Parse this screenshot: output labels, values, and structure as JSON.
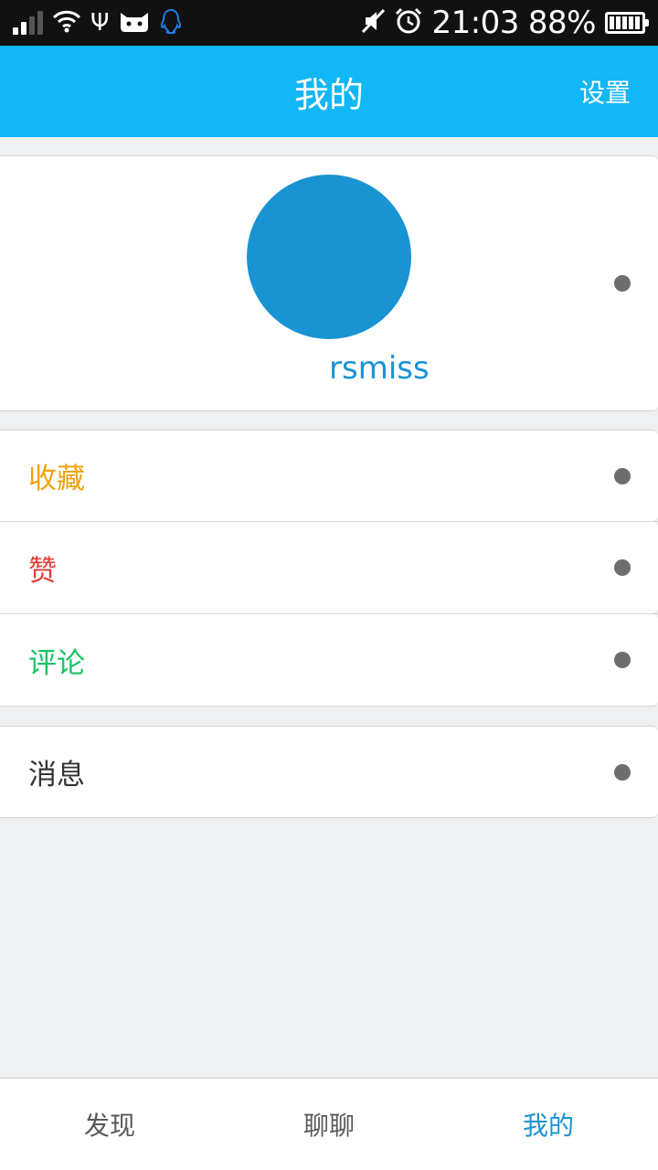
{
  "status_bar": {
    "time": "21:03",
    "battery": "88%",
    "icons": [
      "signal-icon",
      "wifi-icon",
      "usb-icon",
      "cat-icon",
      "qq-penguin-icon",
      "mute-icon",
      "alarm-icon",
      "battery-icon"
    ]
  },
  "header": {
    "title": "我的",
    "settings_label": "设置"
  },
  "profile": {
    "username": "rsmiss",
    "avatar_color": "#1a93d3"
  },
  "menu": {
    "items": [
      {
        "label": "收藏",
        "color": "#f0a30a"
      },
      {
        "label": "赞",
        "color": "#e0403a"
      },
      {
        "label": "评论",
        "color": "#19c365"
      },
      {
        "label": "消息",
        "color": "#333333"
      }
    ]
  },
  "bottom_nav": {
    "tabs": [
      {
        "label": "发现",
        "color": "#5a5a5a"
      },
      {
        "label": "聊聊",
        "color": "#5a5a5a"
      },
      {
        "label": "我的",
        "color": "#1a93d3",
        "active": true
      }
    ]
  },
  "colors": {
    "accent": "#12b7f5",
    "background": "#eff0f2",
    "chevron_dot": "#6e6e6e"
  }
}
